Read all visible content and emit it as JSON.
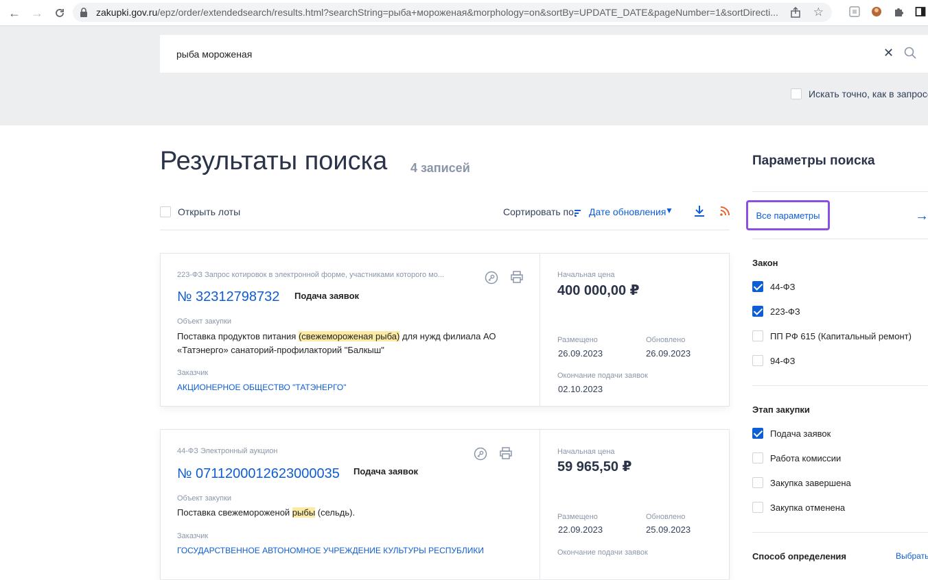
{
  "browser": {
    "url_host": "zakupki.gov.ru",
    "url_path": "/epz/order/extendedsearch/results.html?searchString=рыба+мороженая&morphology=on&sortBy=UPDATE_DATE&pageNumber=1&sortDirecti..."
  },
  "search": {
    "value": "рыба мороженая",
    "exact_label": "Искать точно, как в запросе"
  },
  "results": {
    "title": "Результаты поиска",
    "count": "4 записей",
    "open_lots": "Открыть лоты",
    "sort_label": "Сортировать по:",
    "sort_value": "Дате обновления"
  },
  "cards": [
    {
      "law": "223-ФЗ Запрос котировок в электронной форме, участниками которого мо...",
      "number": "№ 32312798732",
      "stage": "Подача заявок",
      "object_label": "Объект закупки",
      "object_pre": "Поставка продуктов питания ",
      "object_hl": "(свежемороженая рыба)",
      "object_post": " для нужд филиала АО «Татэнерго» санаторий-профилакторий \"Балкыш\"",
      "customer_label": "Заказчик",
      "customer": "АКЦИОНЕРНОЕ ОБЩЕСТВО \"ТАТЭНЕРГО\"",
      "price_label": "Начальная цена",
      "price": "400 000,00 ₽",
      "placed_label": "Размещено",
      "placed": "26.09.2023",
      "updated_label": "Обновлено",
      "updated": "26.09.2023",
      "end_label": "Окончание подачи заявок",
      "end": "02.10.2023"
    },
    {
      "law": "44-ФЗ Электронный аукцион",
      "number": "№ 0711200012623000035",
      "stage": "Подача заявок",
      "object_label": "Объект закупки",
      "object_pre": "Поставка свежемороженой ",
      "object_hl": "рыбы",
      "object_post": " (сельдь).",
      "customer_label": "Заказчик",
      "customer": "ГОСУДАРСТВЕННОЕ АВТОНОМНОЕ УЧРЕЖДЕНИЕ КУЛЬТУРЫ РЕСПУБЛИКИ",
      "price_label": "Начальная цена",
      "price": "59 965,50 ₽",
      "placed_label": "Размещено",
      "placed": "22.09.2023",
      "updated_label": "Обновлено",
      "updated": "25.09.2023",
      "end_label": "Окончание подачи заявок"
    }
  ],
  "sidebar": {
    "title": "Параметры поиска",
    "all_params": "Все параметры",
    "law_title": "Закон",
    "laws": [
      {
        "label": "44-ФЗ",
        "checked": true
      },
      {
        "label": "223-ФЗ",
        "checked": true
      },
      {
        "label": "ПП РФ 615 (Капитальный ремонт)",
        "checked": false
      },
      {
        "label": "94-ФЗ",
        "checked": false
      }
    ],
    "stage_title": "Этап закупки",
    "stages": [
      {
        "label": "Подача заявок",
        "checked": true
      },
      {
        "label": "Работа комиссии",
        "checked": false
      },
      {
        "label": "Закупка завершена",
        "checked": false
      },
      {
        "label": "Закупка отменена",
        "checked": false
      }
    ],
    "method_title": "Способ определения",
    "choose": "Выбрать"
  },
  "colors": {
    "accent": "#0d5dd4",
    "highlight": "#fbeaa3",
    "focus_outline": "#8b4fe0",
    "rss": "#e8622c"
  }
}
